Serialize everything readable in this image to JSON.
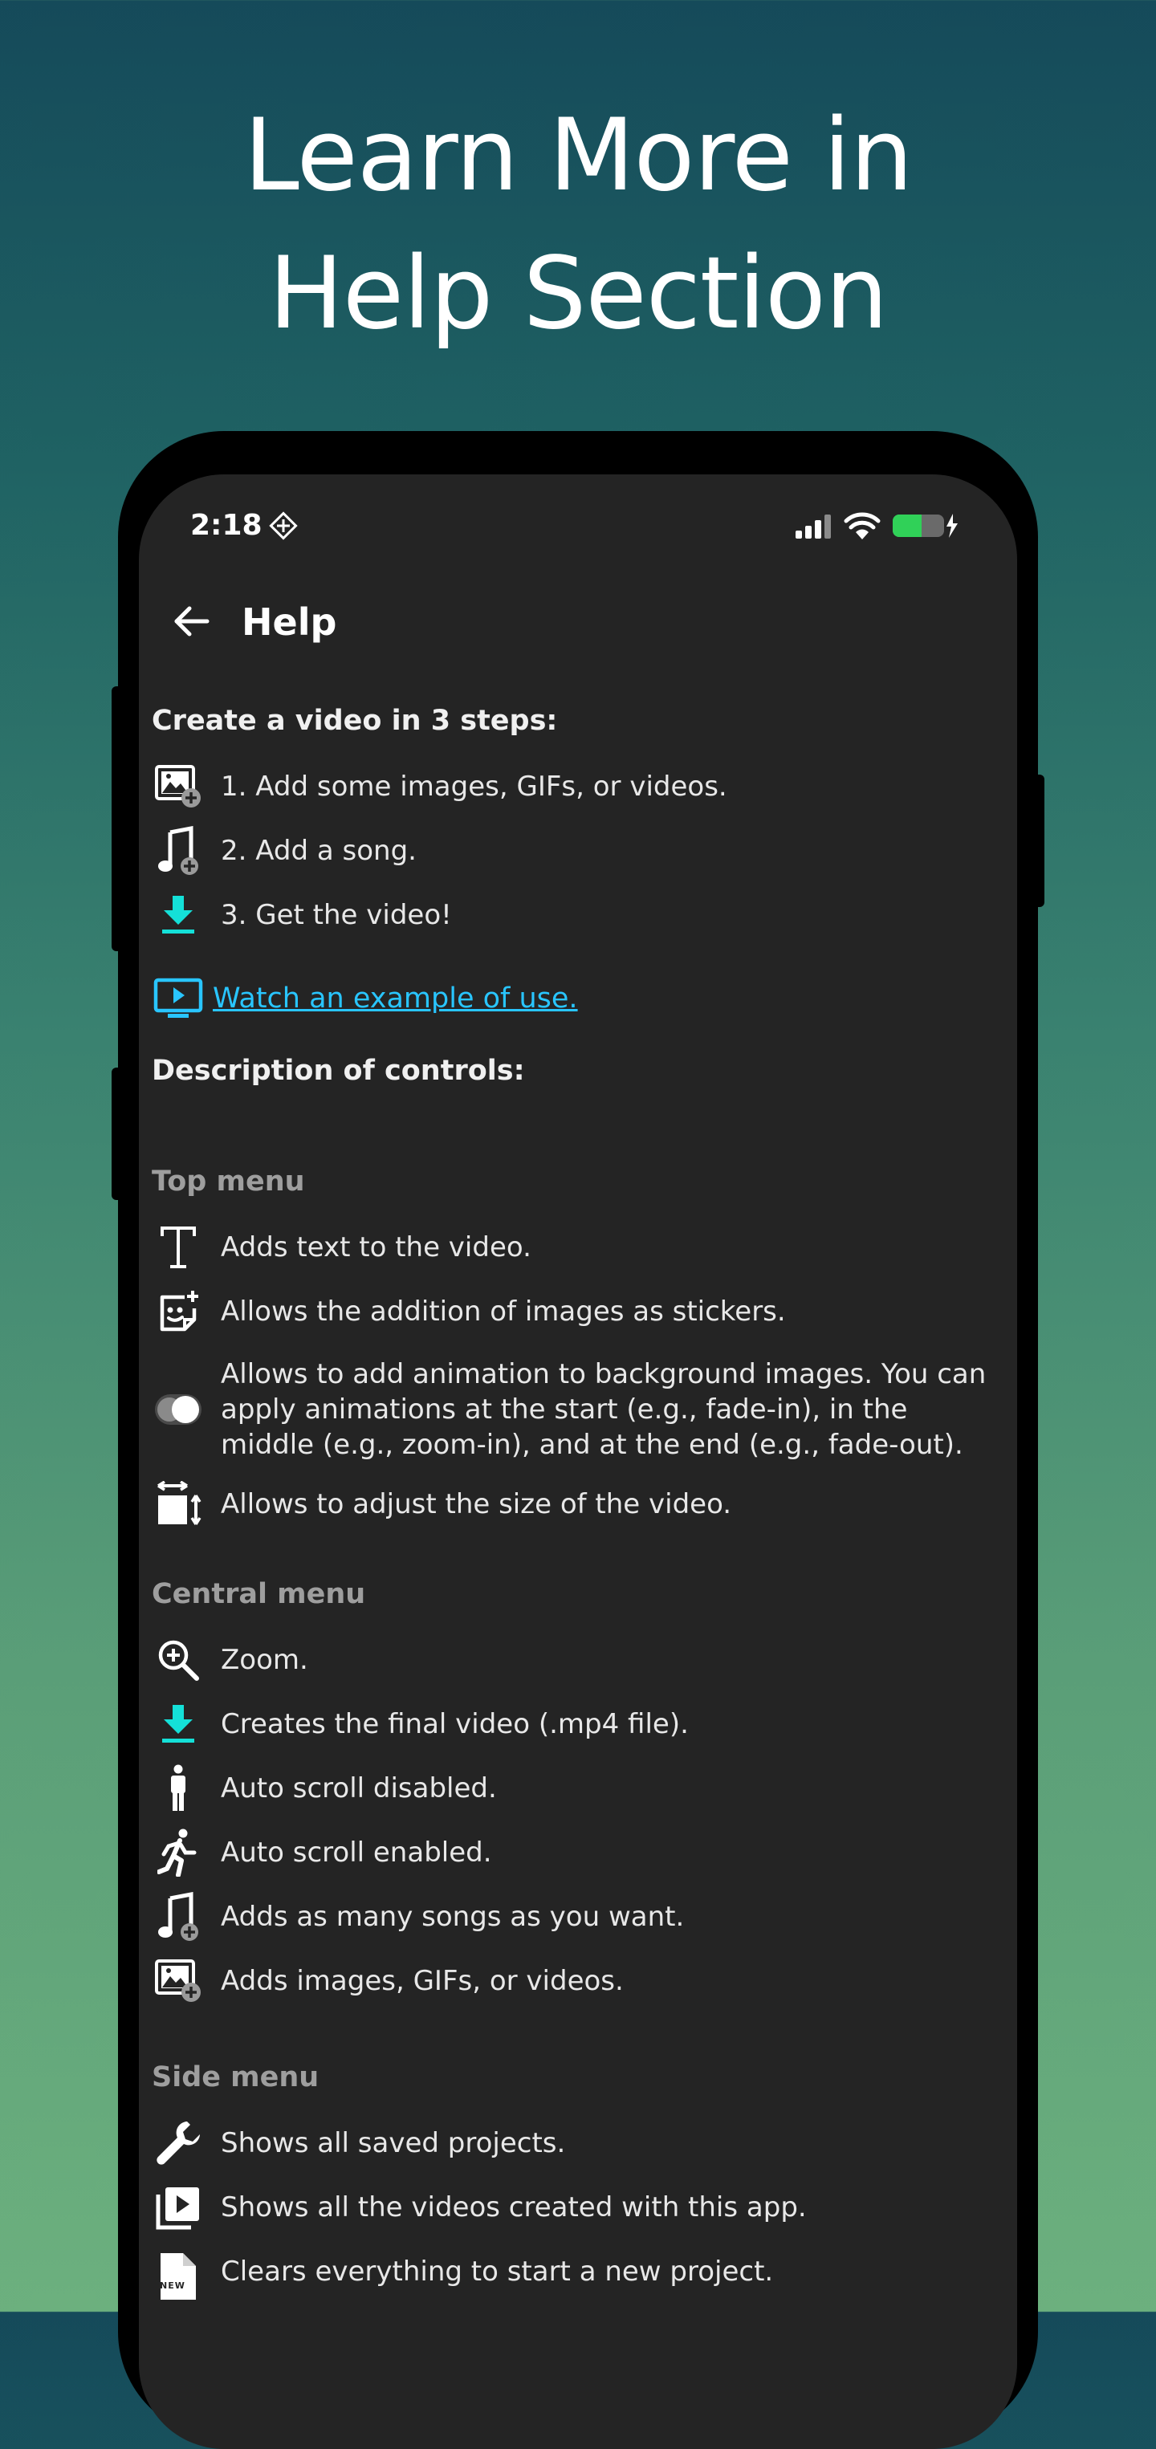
{
  "promo": {
    "headline_line1": "Learn More in",
    "headline_line2": "Help Section"
  },
  "status_bar": {
    "time": "2:18"
  },
  "app_bar": {
    "title": "Help"
  },
  "steps": {
    "heading": "Create a video in 3 steps:",
    "items": [
      {
        "icon": "add-images-icon",
        "label": "1. Add some images, GIFs, or videos."
      },
      {
        "icon": "add-song-icon",
        "label": "2. Add a song."
      },
      {
        "icon": "download-icon",
        "label": "3. Get the video!"
      }
    ]
  },
  "example_link": {
    "icon": "play-video-icon",
    "label": "Watch an example of use."
  },
  "controls": {
    "heading": "Description of controls:"
  },
  "top_menu": {
    "heading": "Top menu",
    "items": [
      {
        "icon": "text-icon",
        "label": "Adds text to the video."
      },
      {
        "icon": "sticker-icon",
        "label": "Allows the addition of images as stickers."
      },
      {
        "icon": "animation-toggle-icon",
        "label": "Allows to add animation to background images. You can apply animations at the start (e.g., fade-in), in the middle (e.g., zoom-in), and at the end (e.g., fade-out)."
      },
      {
        "icon": "resize-icon",
        "label": "Allows to adjust the size of the video."
      }
    ]
  },
  "central_menu": {
    "heading": "Central menu",
    "items": [
      {
        "icon": "zoom-icon",
        "label": "Zoom."
      },
      {
        "icon": "download-icon",
        "label": "Creates the final video (.mp4 file)."
      },
      {
        "icon": "standing-person-icon",
        "label": "Auto scroll disabled."
      },
      {
        "icon": "running-person-icon",
        "label": "Auto scroll enabled."
      },
      {
        "icon": "add-song-icon",
        "label": "Adds as many songs as you want."
      },
      {
        "icon": "add-images-icon",
        "label": "Adds images, GIFs, or videos."
      }
    ]
  },
  "side_menu": {
    "heading": "Side menu",
    "items": [
      {
        "icon": "wrench-icon",
        "label": "Shows all saved projects."
      },
      {
        "icon": "video-library-icon",
        "label": "Shows all the videos created with this app."
      },
      {
        "icon": "new-file-icon",
        "label": "Clears everything to start a new project.",
        "badge": "NEW"
      }
    ]
  },
  "colors": {
    "screen_background": "#242424",
    "accent_cyan": "#14e0d8",
    "link_blue": "#29c5ff",
    "battery_green": "#30d158"
  }
}
